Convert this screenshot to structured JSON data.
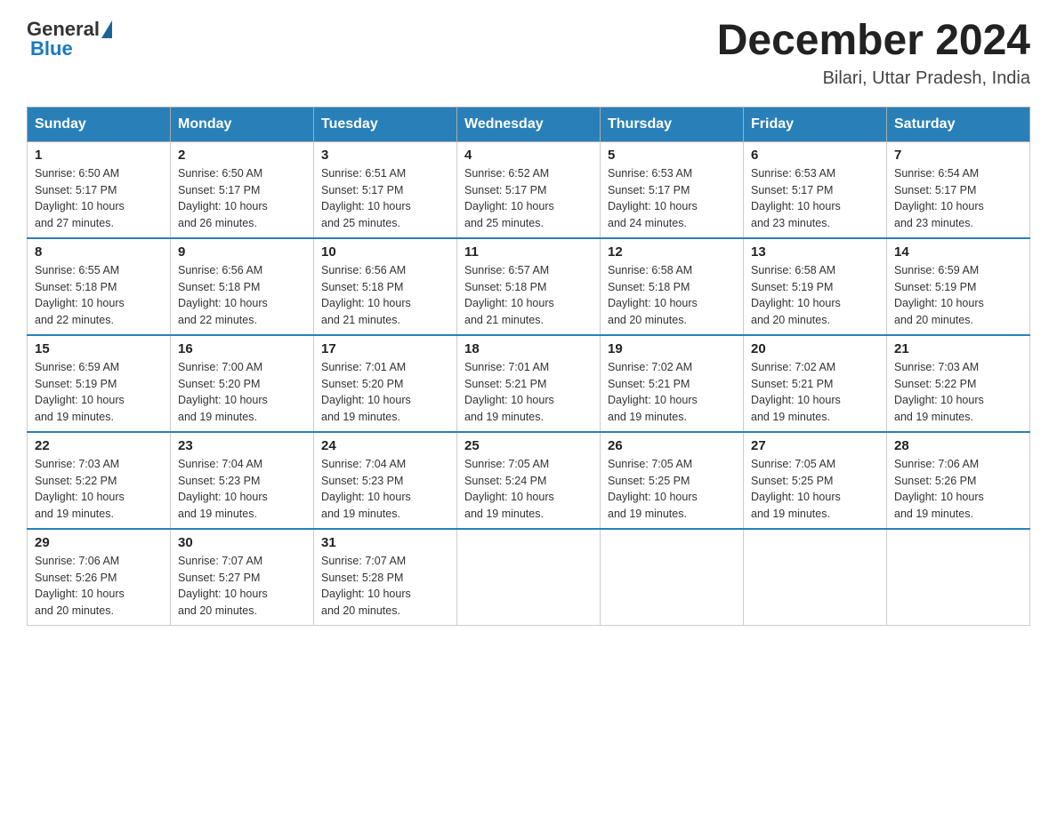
{
  "header": {
    "logo": {
      "general": "General",
      "blue": "Blue"
    },
    "title": "December 2024",
    "location": "Bilari, Uttar Pradesh, India"
  },
  "calendar": {
    "days_of_week": [
      "Sunday",
      "Monday",
      "Tuesday",
      "Wednesday",
      "Thursday",
      "Friday",
      "Saturday"
    ],
    "weeks": [
      [
        {
          "day": "1",
          "sunrise": "6:50 AM",
          "sunset": "5:17 PM",
          "daylight": "10 hours and 27 minutes."
        },
        {
          "day": "2",
          "sunrise": "6:50 AM",
          "sunset": "5:17 PM",
          "daylight": "10 hours and 26 minutes."
        },
        {
          "day": "3",
          "sunrise": "6:51 AM",
          "sunset": "5:17 PM",
          "daylight": "10 hours and 25 minutes."
        },
        {
          "day": "4",
          "sunrise": "6:52 AM",
          "sunset": "5:17 PM",
          "daylight": "10 hours and 25 minutes."
        },
        {
          "day": "5",
          "sunrise": "6:53 AM",
          "sunset": "5:17 PM",
          "daylight": "10 hours and 24 minutes."
        },
        {
          "day": "6",
          "sunrise": "6:53 AM",
          "sunset": "5:17 PM",
          "daylight": "10 hours and 23 minutes."
        },
        {
          "day": "7",
          "sunrise": "6:54 AM",
          "sunset": "5:17 PM",
          "daylight": "10 hours and 23 minutes."
        }
      ],
      [
        {
          "day": "8",
          "sunrise": "6:55 AM",
          "sunset": "5:18 PM",
          "daylight": "10 hours and 22 minutes."
        },
        {
          "day": "9",
          "sunrise": "6:56 AM",
          "sunset": "5:18 PM",
          "daylight": "10 hours and 22 minutes."
        },
        {
          "day": "10",
          "sunrise": "6:56 AM",
          "sunset": "5:18 PM",
          "daylight": "10 hours and 21 minutes."
        },
        {
          "day": "11",
          "sunrise": "6:57 AM",
          "sunset": "5:18 PM",
          "daylight": "10 hours and 21 minutes."
        },
        {
          "day": "12",
          "sunrise": "6:58 AM",
          "sunset": "5:18 PM",
          "daylight": "10 hours and 20 minutes."
        },
        {
          "day": "13",
          "sunrise": "6:58 AM",
          "sunset": "5:19 PM",
          "daylight": "10 hours and 20 minutes."
        },
        {
          "day": "14",
          "sunrise": "6:59 AM",
          "sunset": "5:19 PM",
          "daylight": "10 hours and 20 minutes."
        }
      ],
      [
        {
          "day": "15",
          "sunrise": "6:59 AM",
          "sunset": "5:19 PM",
          "daylight": "10 hours and 19 minutes."
        },
        {
          "day": "16",
          "sunrise": "7:00 AM",
          "sunset": "5:20 PM",
          "daylight": "10 hours and 19 minutes."
        },
        {
          "day": "17",
          "sunrise": "7:01 AM",
          "sunset": "5:20 PM",
          "daylight": "10 hours and 19 minutes."
        },
        {
          "day": "18",
          "sunrise": "7:01 AM",
          "sunset": "5:21 PM",
          "daylight": "10 hours and 19 minutes."
        },
        {
          "day": "19",
          "sunrise": "7:02 AM",
          "sunset": "5:21 PM",
          "daylight": "10 hours and 19 minutes."
        },
        {
          "day": "20",
          "sunrise": "7:02 AM",
          "sunset": "5:21 PM",
          "daylight": "10 hours and 19 minutes."
        },
        {
          "day": "21",
          "sunrise": "7:03 AM",
          "sunset": "5:22 PM",
          "daylight": "10 hours and 19 minutes."
        }
      ],
      [
        {
          "day": "22",
          "sunrise": "7:03 AM",
          "sunset": "5:22 PM",
          "daylight": "10 hours and 19 minutes."
        },
        {
          "day": "23",
          "sunrise": "7:04 AM",
          "sunset": "5:23 PM",
          "daylight": "10 hours and 19 minutes."
        },
        {
          "day": "24",
          "sunrise": "7:04 AM",
          "sunset": "5:23 PM",
          "daylight": "10 hours and 19 minutes."
        },
        {
          "day": "25",
          "sunrise": "7:05 AM",
          "sunset": "5:24 PM",
          "daylight": "10 hours and 19 minutes."
        },
        {
          "day": "26",
          "sunrise": "7:05 AM",
          "sunset": "5:25 PM",
          "daylight": "10 hours and 19 minutes."
        },
        {
          "day": "27",
          "sunrise": "7:05 AM",
          "sunset": "5:25 PM",
          "daylight": "10 hours and 19 minutes."
        },
        {
          "day": "28",
          "sunrise": "7:06 AM",
          "sunset": "5:26 PM",
          "daylight": "10 hours and 19 minutes."
        }
      ],
      [
        {
          "day": "29",
          "sunrise": "7:06 AM",
          "sunset": "5:26 PM",
          "daylight": "10 hours and 20 minutes."
        },
        {
          "day": "30",
          "sunrise": "7:07 AM",
          "sunset": "5:27 PM",
          "daylight": "10 hours and 20 minutes."
        },
        {
          "day": "31",
          "sunrise": "7:07 AM",
          "sunset": "5:28 PM",
          "daylight": "10 hours and 20 minutes."
        },
        null,
        null,
        null,
        null
      ]
    ]
  },
  "labels": {
    "sunrise": "Sunrise:",
    "sunset": "Sunset:",
    "daylight": "Daylight:"
  }
}
